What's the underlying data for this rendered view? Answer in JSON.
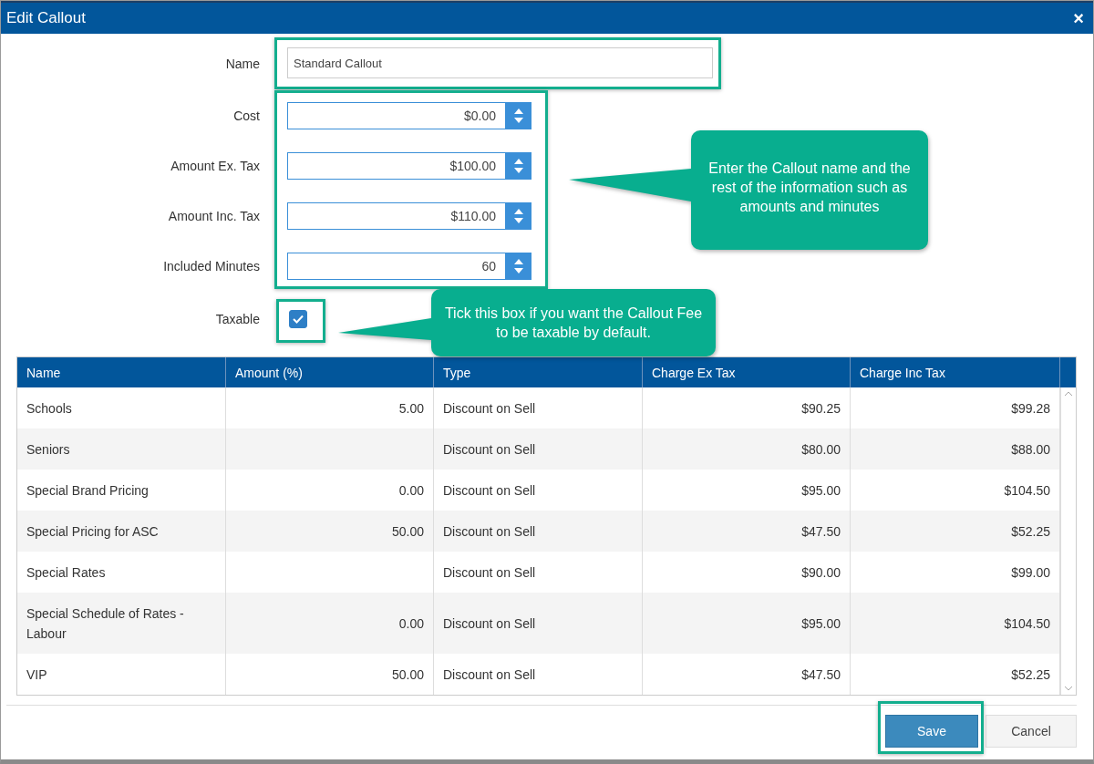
{
  "window": {
    "title": "Edit Callout",
    "close": "×"
  },
  "form": {
    "fields": [
      {
        "label": "Name",
        "kind": "text",
        "value": "Standard Callout"
      },
      {
        "label": "Cost",
        "kind": "number",
        "value": "$0.00"
      },
      {
        "label": "Amount Ex. Tax",
        "kind": "number",
        "value": "$100.00"
      },
      {
        "label": "Amount Inc. Tax",
        "kind": "number",
        "value": "$110.00"
      },
      {
        "label": "Included Minutes",
        "kind": "number",
        "value": "60"
      }
    ],
    "taxable": {
      "label": "Taxable",
      "checked": true
    }
  },
  "callouts": [
    {
      "text": "Enter the Callout name and the rest of the information such as amounts and minutes"
    },
    {
      "text": "Tick this box if you want the Callout Fee to be taxable by default."
    }
  ],
  "table": {
    "columns": [
      "Name",
      "Amount (%)",
      "Type",
      "Charge Ex Tax",
      "Charge Inc Tax"
    ],
    "rows": [
      [
        "Schools",
        "5.00",
        "Discount on Sell",
        "$90.25",
        "$99.28"
      ],
      [
        "Seniors",
        "",
        "Discount on Sell",
        "$80.00",
        "$88.00"
      ],
      [
        "Special Brand Pricing",
        "0.00",
        "Discount on Sell",
        "$95.00",
        "$104.50"
      ],
      [
        "Special Pricing for ASC",
        "50.00",
        "Discount on Sell",
        "$47.50",
        "$52.25"
      ],
      [
        "Special Rates",
        "",
        "Discount on Sell",
        "$90.00",
        "$99.00"
      ],
      [
        "Special Schedule of Rates - Labour",
        "0.00",
        "Discount on Sell",
        "$95.00",
        "$104.50"
      ],
      [
        "VIP",
        "50.00",
        "Discount on Sell",
        "$47.50",
        "$52.25"
      ]
    ]
  },
  "buttons": [
    {
      "label": "Save",
      "kind": "primary"
    },
    {
      "label": "Cancel",
      "kind": "secondary"
    }
  ]
}
